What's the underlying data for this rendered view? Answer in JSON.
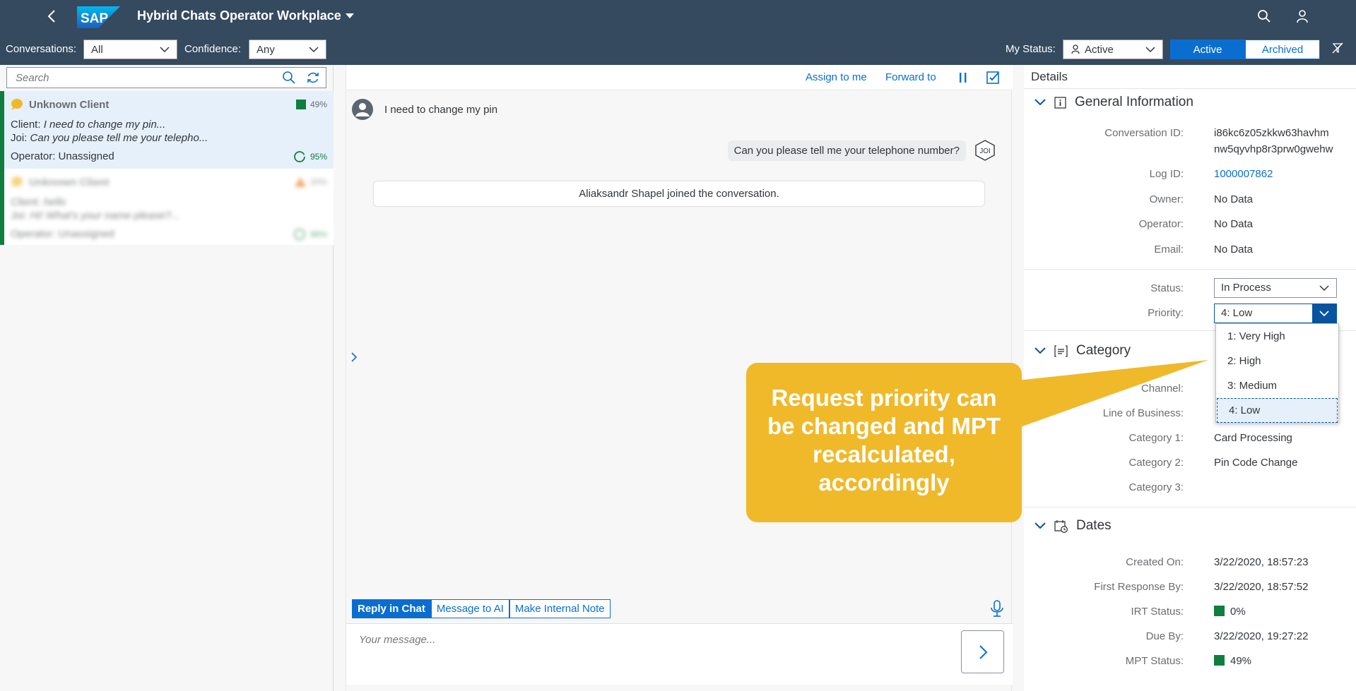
{
  "shell": {
    "title": "Hybrid Chats Operator Workplace",
    "logo_text": "SAP"
  },
  "filters": {
    "conversations_label": "Conversations:",
    "conversations_value": "All",
    "confidence_label": "Confidence:",
    "confidence_value": "Any",
    "my_status_label": "My Status:",
    "my_status_value": "Active",
    "segments": [
      "Active",
      "Archived"
    ]
  },
  "list": {
    "search_placeholder": "Search",
    "items": [
      {
        "title": "Unknown Client",
        "badge": "49%",
        "client_prefix": "Client:",
        "client_msg": "I need to change my pin...",
        "joi_prefix": "Joi:",
        "joi_msg": "Can you please tell me your telepho...",
        "operator": "Operator: Unassigned",
        "confidence": "95%"
      },
      {
        "title": "Unknown Client",
        "badge": "20%",
        "client_prefix": "Client:",
        "client_msg": "hello",
        "joi_prefix": "Joi:",
        "joi_msg": "Hi! What's your name please?...",
        "operator": "Operator: Unassigned",
        "confidence": "98%"
      }
    ]
  },
  "chat": {
    "assign": "Assign to me",
    "forward": "Forward to",
    "client_message": "I need to change my pin",
    "bot_message": "Can you please tell me your telephone number?",
    "bot_avatar": "JOI",
    "system_message": "Aliaksandr Shapel joined the conversation.",
    "tabs": [
      "Reply in Chat",
      "Message to AI",
      "Make Internal Note"
    ],
    "compose_placeholder": "Your message..."
  },
  "details": {
    "title": "Details",
    "general": {
      "heading": "General Information",
      "conversation_id_label": "Conversation ID:",
      "conversation_id_line1": "i86kc6z05zkkw63havhm",
      "conversation_id_line2": "nw5qyvhp8r3prw0gwehw",
      "log_id_label": "Log ID:",
      "log_id": "1000007862",
      "owner_label": "Owner:",
      "owner": "No Data",
      "operator_label": "Operator:",
      "operator": "No Data",
      "email_label": "Email:",
      "email": "No Data",
      "status_label": "Status:",
      "status": "In Process",
      "priority_label": "Priority:",
      "priority": "4: Low"
    },
    "priority_options": [
      "1: Very High",
      "2: High",
      "3: Medium",
      "4: Low"
    ],
    "category": {
      "heading": "Category",
      "channel_label": "Channel:",
      "lob_label": "Line of Business:",
      "cat1_label": "Category 1:",
      "cat1": "Card Processing",
      "cat2_label": "Category 2:",
      "cat2": "Pin Code Change",
      "cat3_label": "Category 3:"
    },
    "dates": {
      "heading": "Dates",
      "created_label": "Created On:",
      "created": "3/22/2020, 18:57:23",
      "first_resp_label": "First Response By:",
      "first_resp": "3/22/2020, 18:57:52",
      "irt_label": "IRT Status:",
      "irt": "0%",
      "due_label": "Due By:",
      "due": "3/22/2020, 19:27:22",
      "mpt_label": "MPT Status:",
      "mpt": "49%"
    }
  },
  "callout": {
    "text": "Request priority can be changed and MPT recalculated, accordingly"
  },
  "colors": {
    "shell": "#354a5f",
    "accent": "#0a6ed1",
    "positive": "#107e3e",
    "callout": "#f0b929"
  }
}
